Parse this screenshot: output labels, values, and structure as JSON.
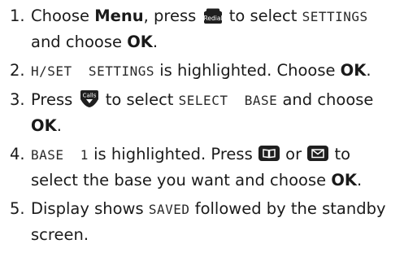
{
  "steps": [
    {
      "number": "1.",
      "parts": {
        "t1": "Choose ",
        "menu": "Menu",
        "t2": ", press ",
        "key": "Redial",
        "t3": " to select ",
        "lcd": "SETTINGS",
        "t4": " and choose ",
        "ok": "OK",
        "t5": "."
      },
      "icons": [
        "redial-key-icon"
      ]
    },
    {
      "number": "2.",
      "parts": {
        "lcd": "H/SET  SETTINGS",
        "t1": " is highlighted. Choose ",
        "ok": "OK",
        "t2": "."
      }
    },
    {
      "number": "3.",
      "parts": {
        "t1": "Press ",
        "key": "Calls",
        "t2": " to select ",
        "lcd": "SELECT  BASE",
        "t3": " and choose ",
        "ok": "OK",
        "t4": "."
      },
      "icons": [
        "calls-key-icon"
      ]
    },
    {
      "number": "4.",
      "parts": {
        "lcd": "BASE  1",
        "t1": " is highlighted. Press ",
        "t2": " or ",
        "t3": " to select the base you want and choose ",
        "ok": "OK",
        "t4": "."
      },
      "icons": [
        "phonebook-key-icon",
        "message-key-icon"
      ]
    },
    {
      "number": "5.",
      "parts": {
        "t1": "Display shows ",
        "lcd": "SAVED",
        "t2": "  followed by the standby screen."
      }
    }
  ],
  "colors": {
    "text": "#1a1a1a",
    "key": "#1f1f1f",
    "key_symbol": "#ffffff"
  }
}
